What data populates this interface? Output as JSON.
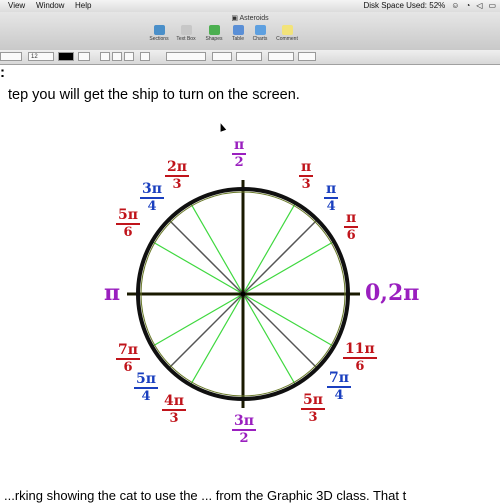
{
  "menubar": {
    "items": [
      "View",
      "Window",
      "Help"
    ],
    "disk": "Disk Space Used: 52%"
  },
  "toolbar": {
    "title": "Asteroids",
    "buttons": [
      {
        "label": "Sections",
        "color": "#4a8fc9"
      },
      {
        "label": "Text Box",
        "color": "#c7c7c7"
      },
      {
        "label": "Shapes",
        "color": "#4caf50"
      },
      {
        "label": "Table",
        "color": "#5a8fd6"
      },
      {
        "label": "Charts",
        "color": "#5ea0e0"
      },
      {
        "label": "Comment",
        "color": "#f2e37a"
      }
    ]
  },
  "format": {
    "font_size": "12"
  },
  "document": {
    "heading": ":",
    "intro": "tep you will get the ship to turn on the screen.",
    "bottom": "...rking showing the cat to use the ... from the Graphic 3D class. That t"
  },
  "unit_circle": {
    "colors": {
      "red": "#c0141b",
      "blue": "#1a3fbf",
      "purple": "#9a1fbf",
      "green": "#3fd83f",
      "gray": "#555555",
      "circle": "#101010",
      "axes": "#1a1a00"
    },
    "right_label": "0,2π",
    "left_label": "π",
    "fractions": [
      {
        "num": "π",
        "den": "2",
        "color": "purple"
      },
      {
        "num": "π",
        "den": "3",
        "color": "red"
      },
      {
        "num": "π",
        "den": "4",
        "color": "blue"
      },
      {
        "num": "π",
        "den": "6",
        "color": "red"
      },
      {
        "num": "2π",
        "den": "3",
        "color": "red"
      },
      {
        "num": "3π",
        "den": "4",
        "color": "blue"
      },
      {
        "num": "5π",
        "den": "6",
        "color": "red"
      },
      {
        "num": "7π",
        "den": "6",
        "color": "red"
      },
      {
        "num": "5π",
        "den": "4",
        "color": "blue"
      },
      {
        "num": "4π",
        "den": "3",
        "color": "red"
      },
      {
        "num": "3π",
        "den": "2",
        "color": "purple"
      },
      {
        "num": "5π",
        "den": "3",
        "color": "red"
      },
      {
        "num": "7π",
        "den": "4",
        "color": "blue"
      },
      {
        "num": "11π",
        "den": "6",
        "color": "red"
      }
    ]
  }
}
